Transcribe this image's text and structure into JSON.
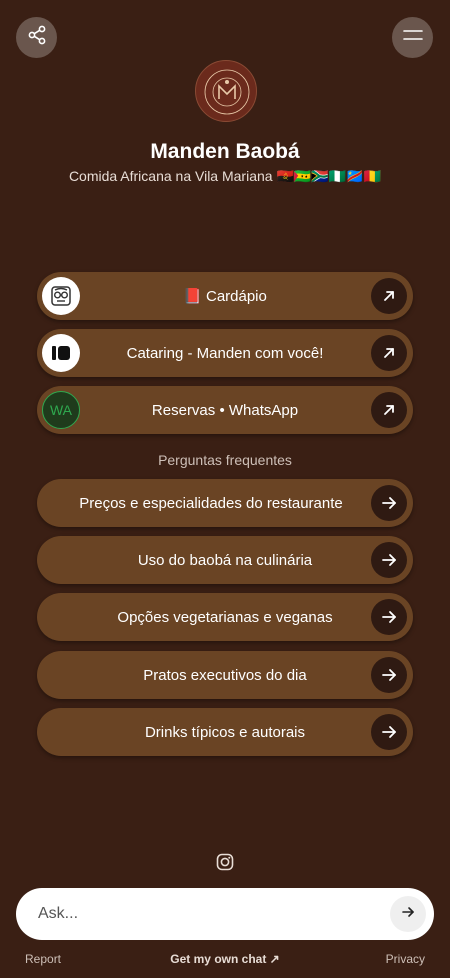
{
  "header": {
    "share_icon": "share-icon",
    "menu_icon": "menu-icon"
  },
  "profile": {
    "logo_text": "MANDEN · CULINÁRIA AFRICANA · BOTECO",
    "logo_monogram": "M",
    "name": "Manden Baobá",
    "subtitle": "Comida Africana na Vila Mariana 🇦🇴🇸🇹🇿🇦🇳🇬🇨🇩🇬🇳"
  },
  "links": [
    {
      "label": "📕 Cardápio",
      "icon": "menu-book-icon"
    },
    {
      "label": "Cataring - Manden com você!",
      "icon": "brand-icon"
    },
    {
      "label": "Reservas • WhatsApp",
      "icon": "whatsapp-icon",
      "thumb_text": "WA"
    }
  ],
  "faq": {
    "title": "Perguntas frequentes",
    "items": [
      "Preços e especialidades do restaurante",
      "Uso do baobá na culinária",
      "Opções vegetarianas e veganas",
      "Pratos executivos do dia",
      "Drinks típicos e autorais"
    ]
  },
  "chat": {
    "placeholder": "Ask..."
  },
  "footer": {
    "report": "Report",
    "get_chat": "Get my own chat ↗",
    "privacy": "Privacy"
  },
  "colors": {
    "background": "#3a1f14",
    "button": "#6a4424",
    "arrow_bg": "#2f1a12"
  }
}
